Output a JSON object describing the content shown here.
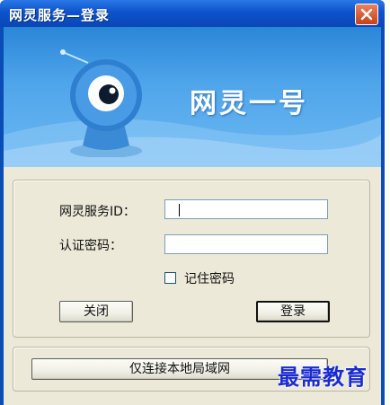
{
  "window": {
    "title": "网灵服务—登录",
    "close_icon": "close-icon"
  },
  "banner": {
    "title": "网灵一号",
    "mascot_icon": "webcam-mascot-icon"
  },
  "login": {
    "service_id_label": "网灵服务ID：",
    "service_id_value": "",
    "password_label": "认证密码：",
    "password_value": "",
    "remember_label": "记住密码",
    "remember_checked": false,
    "close_button": "关闭",
    "login_button": "登录"
  },
  "local": {
    "button": "仅连接本地局域网"
  },
  "watermark": "最需教育",
  "colors": {
    "titlebar": "#0d52cc",
    "banner": "#4fa5ea",
    "dialog_bg": "#ece9d8",
    "close_button": "#c6401a",
    "watermark": "#1a2bd0"
  }
}
